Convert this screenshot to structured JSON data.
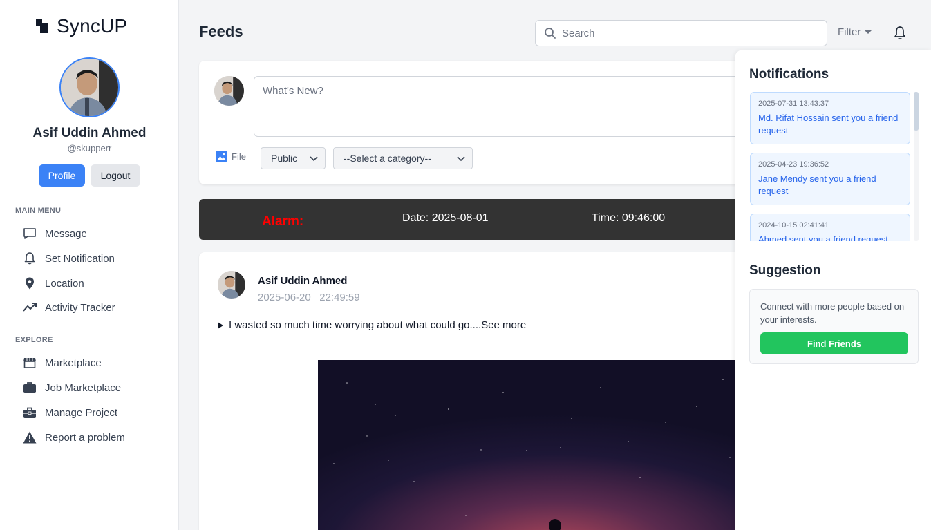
{
  "brand": {
    "name": "SyncUP"
  },
  "user": {
    "name": "Asif Uddin Ahmed",
    "handle": "@skupperr"
  },
  "sidebar": {
    "profile_label": "Profile",
    "logout_label": "Logout",
    "main_menu_label": "MAIN MENU",
    "main_menu": [
      {
        "label": "Message",
        "icon": "message-icon"
      },
      {
        "label": "Set Notification",
        "icon": "bell-icon"
      },
      {
        "label": "Location",
        "icon": "location-pin-icon"
      },
      {
        "label": "Activity Tracker",
        "icon": "activity-chart-icon"
      }
    ],
    "explore_label": "EXPLORE",
    "explore": [
      {
        "label": "Marketplace",
        "icon": "store-icon"
      },
      {
        "label": "Job Marketplace",
        "icon": "briefcase-icon"
      },
      {
        "label": "Manage Project",
        "icon": "toolbox-icon"
      },
      {
        "label": "Report a problem",
        "icon": "warning-icon"
      }
    ]
  },
  "header": {
    "title": "Feeds",
    "search_placeholder": "Search",
    "filter_label": "Filter"
  },
  "composer": {
    "placeholder": "What's New?",
    "file_label": "File",
    "visibility": "Public",
    "category": "--Select a category--"
  },
  "alarm": {
    "label": "Alarm:",
    "date": "Date: 2025-08-01",
    "time": "Time: 09:46:00"
  },
  "post": {
    "author": "Asif Uddin Ahmed",
    "timestamp": "2025-06-20   22:49:59",
    "text": "I wasted so much time worrying about what could go....See more"
  },
  "notifications": {
    "title": "Notifications",
    "items": [
      {
        "date": "2025-07-31 13:43:37",
        "text": "Md. Rifat Hossain sent you a friend request"
      },
      {
        "date": "2025-04-23 19:36:52",
        "text": "Jane Mendy sent you a friend request"
      },
      {
        "date": "2024-10-15 02:41:41",
        "text": "Ahmed sent you a friend request"
      }
    ]
  },
  "suggestion": {
    "title": "Suggestion",
    "text": "Connect with more people based on your interests.",
    "button_label": "Find Friends"
  },
  "colors": {
    "primary": "#3b82f6",
    "alarm_bg": "#333333",
    "alarm_label": "#ff0000",
    "success": "#22c55e",
    "notif_text": "#2563eb"
  }
}
